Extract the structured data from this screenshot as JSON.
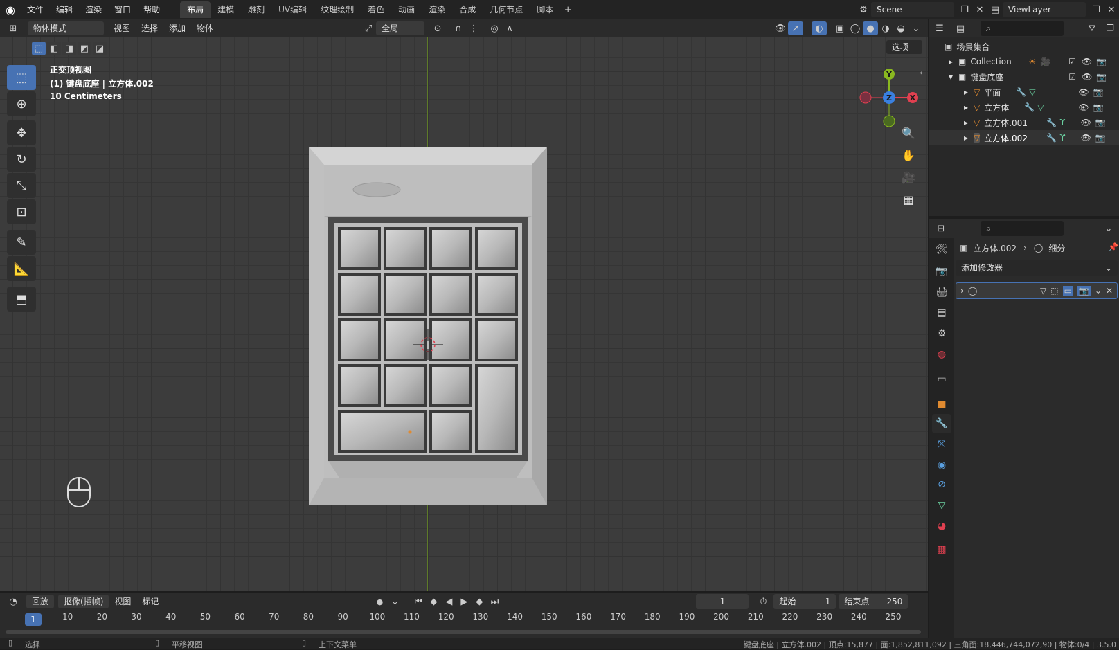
{
  "menubar": {
    "items": [
      "文件",
      "编辑",
      "渲染",
      "窗口",
      "帮助"
    ]
  },
  "workspaces": [
    "布局",
    "建模",
    "雕刻",
    "UV编辑",
    "纹理绘制",
    "着色",
    "动画",
    "渲染",
    "合成",
    "几何节点",
    "脚本"
  ],
  "active_workspace": "布局",
  "scene": {
    "label": "Scene"
  },
  "view_layer": {
    "label": "ViewLayer"
  },
  "viewport_header": {
    "mode": "物体模式",
    "menus": [
      "视图",
      "选择",
      "添加",
      "物体"
    ],
    "transform_orientation": "全局",
    "options_label": "选项"
  },
  "viewport_overlay": {
    "view_name": "正交顶视图",
    "object_info": "(1) 键盘底座 | 立方体.002",
    "scale": "10 Centimeters"
  },
  "gizmo": {
    "y": "Y",
    "z": "Z",
    "x": "X"
  },
  "outliner": {
    "root": "场景集合",
    "rows": [
      {
        "name": "Collection",
        "level": 1
      },
      {
        "name": "键盘底座",
        "level": 1
      },
      {
        "name": "平面",
        "level": 2
      },
      {
        "name": "立方体",
        "level": 2
      },
      {
        "name": "立方体.001",
        "level": 2
      },
      {
        "name": "立方体.002",
        "level": 2
      }
    ]
  },
  "properties": {
    "object": "立方体.002",
    "modifier": "细分",
    "add_modifier": "添加修改器"
  },
  "timeline": {
    "menus": [
      "回放",
      "抠像(插帧)",
      "视图",
      "标记"
    ],
    "current_frame": "1",
    "start_label": "起始",
    "start": "1",
    "end_label": "结束点",
    "end": "250",
    "ticks": [
      "1",
      "10",
      "20",
      "30",
      "40",
      "50",
      "60",
      "70",
      "80",
      "90",
      "100",
      "110",
      "120",
      "130",
      "140",
      "150",
      "160",
      "170",
      "180",
      "190",
      "200",
      "210",
      "220",
      "230",
      "240",
      "250"
    ]
  },
  "statusbar": {
    "select": "选择",
    "pan": "平移视图",
    "context": "上下文菜单",
    "stats": "键盘底座 | 立方体.002 | 顶点:15,877 | 面:1,852,811,092 | 三角面:18,446,744,072,90 | 物体:0/4 | 3.5.0"
  },
  "colors": {
    "accent": "#4772b3",
    "axis_x": "#e04050",
    "axis_y": "#8ab820",
    "axis_z": "#3a80e0",
    "object_orange": "#e08a30"
  }
}
